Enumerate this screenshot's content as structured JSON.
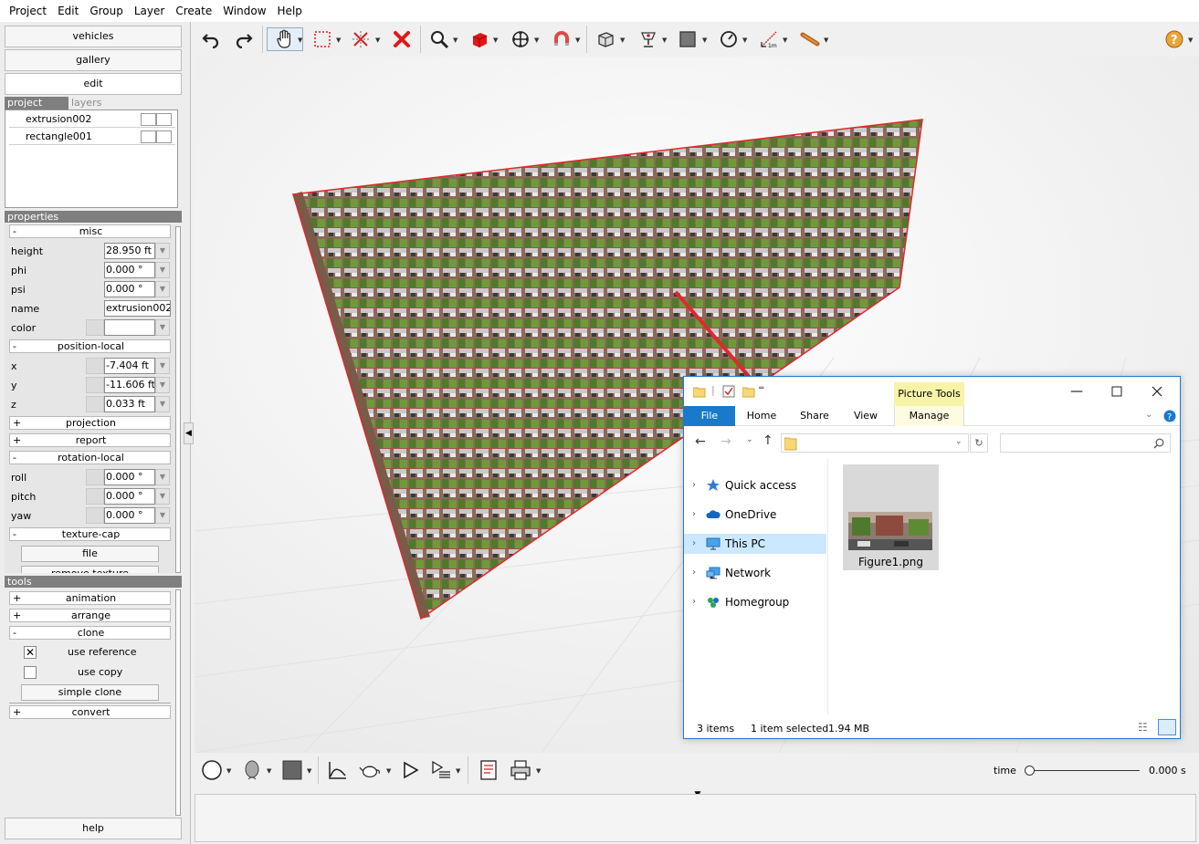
{
  "menubar": [
    "Project",
    "Edit",
    "Group",
    "Layer",
    "Create",
    "Window",
    "Help"
  ],
  "left_panel": {
    "buttons": {
      "vehicles": "vehicles",
      "gallery": "gallery",
      "edit": "edit",
      "help": "help"
    },
    "tabs": {
      "project": "project",
      "layers": "layers"
    },
    "layers": [
      "extrusion002",
      "rectangle001"
    ],
    "properties_header": "properties",
    "misc": {
      "toggle": "-",
      "title": "misc",
      "height_label": "height",
      "height": "28.950 ft",
      "phi_label": "phi",
      "phi": "0.000 °",
      "psi_label": "psi",
      "psi": "0.000 °",
      "name_label": "name",
      "name": "extrusion002",
      "color_label": "color",
      "color": ""
    },
    "position_local": {
      "toggle": "-",
      "title": "position-local",
      "x_label": "x",
      "x": "-7.404 ft",
      "y_label": "y",
      "y": "-11.606 ft",
      "z_label": "z",
      "z": "0.033 ft"
    },
    "projection": {
      "toggle": "+",
      "title": "projection"
    },
    "report": {
      "toggle": "+",
      "title": "report"
    },
    "rotation_local": {
      "toggle": "-",
      "title": "rotation-local",
      "roll_label": "roll",
      "roll": "0.000 °",
      "pitch_label": "pitch",
      "pitch": "0.000 °",
      "yaw_label": "yaw",
      "yaw": "0.000 °"
    },
    "texture_cap": {
      "toggle": "-",
      "title": "texture-cap",
      "file_button": "file",
      "remove_button": "remove texture"
    },
    "tools_header": "tools",
    "tools": {
      "animation": {
        "toggle": "+",
        "title": "animation"
      },
      "arrange": {
        "toggle": "+",
        "title": "arrange"
      },
      "clone": {
        "toggle": "-",
        "title": "clone",
        "use_reference": "use reference",
        "use_reference_checked": "✕",
        "use_copy": "use copy",
        "simple_clone": "simple clone"
      },
      "convert": {
        "toggle": "+",
        "title": "convert"
      }
    }
  },
  "bottombar": {
    "time_label": "time",
    "time_value": "0.000 s",
    "slider_position": 0
  },
  "explorer": {
    "picture_tools": "Picture Tools",
    "tabs": {
      "file": "File",
      "home": "Home",
      "share": "Share",
      "view": "View",
      "manage": "Manage"
    },
    "address": "",
    "search_placeholder": "",
    "nav": [
      "Quick access",
      "OneDrive",
      "This PC",
      "Network",
      "Homegroup"
    ],
    "selected_nav": "This PC",
    "file_name": "Figure1.png",
    "status": {
      "items": "3 items",
      "selected": "1 item selected",
      "size": "1.94 MB"
    }
  },
  "colors": {
    "accent": "#1e7ad4",
    "file_tab": "#1979ca",
    "picture_tools": "#f7f3a8",
    "wall_outline": "#e0282d"
  }
}
